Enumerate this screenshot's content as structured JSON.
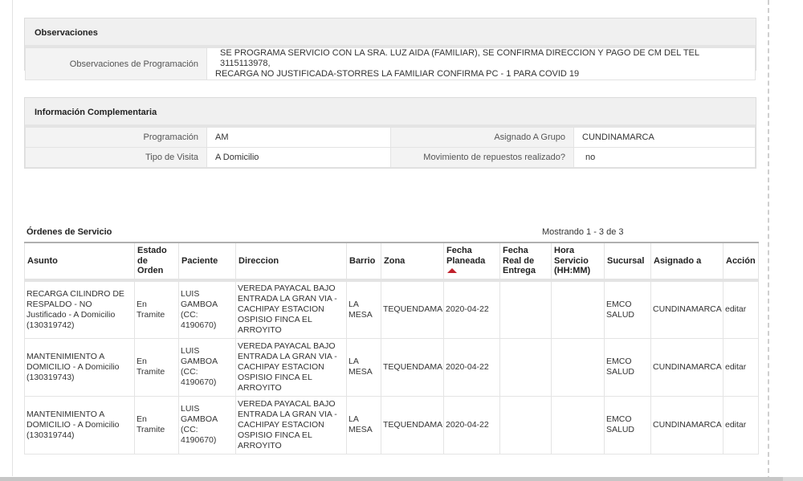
{
  "observaciones": {
    "title": "Observaciones",
    "label": "Observaciones de Programación",
    "value_line1": "SE PROGRAMA SERVICIO CON LA SRA. LUZ AIDA (FAMILIAR), SE CONFIRMA DIRECCION Y PAGO DE CM DEL TEL 3115113978,",
    "value_line2": "RECARGA NO JUSTIFICADA-STORRES LA FAMILIAR CONFIRMA PC - 1 PARA COVID 19"
  },
  "info": {
    "title": "Información Complementaria",
    "programacion_label": "Programación",
    "programacion_value": "AM",
    "grupo_label": "Asignado A Grupo",
    "grupo_value": "CUNDINAMARCA",
    "visita_label": "Tipo de Visita",
    "visita_value": "A Domicilio",
    "repuestos_label": "Movimiento de repuestos realizado?",
    "repuestos_value": "no"
  },
  "orders": {
    "title": "Órdenes de Servicio",
    "count_text": "Mostrando 1 - 3 de 3",
    "sort_color": "#c0202a",
    "headers": {
      "asunto": "Asunto",
      "estado": "Estado de Orden",
      "paciente": "Paciente",
      "direccion": "Direccion",
      "barrio": "Barrio",
      "zona": "Zona",
      "fecha_planeada": "Fecha Planeada",
      "fecha_real": "Fecha Real de Entrega",
      "hora": "Hora Servicio (HH:MM)",
      "sucursal": "Sucursal",
      "asignado": "Asignado a",
      "accion": "Acción"
    },
    "rows": [
      {
        "asunto": "RECARGA CILINDRO DE RESPALDO - NO Justificado - A Domicilio (130319742)",
        "estado": "En Tramite",
        "paciente": "LUIS GAMBOA (CC: 4190670)",
        "direccion": "VEREDA PAYACAL BAJO ENTRADA LA GRAN VIA - CACHIPAY ESTACION OSPISIO FINCA EL ARROYITO",
        "barrio": "LA MESA",
        "zona": "TEQUENDAMA",
        "fecha_planeada": "2020-04-22",
        "fecha_real": "",
        "hora": "",
        "sucursal": "EMCO SALUD",
        "asignado": "CUNDINAMARCA",
        "accion": "editar"
      },
      {
        "asunto": "MANTENIMIENTO A DOMICILIO - A Domicilio (130319743)",
        "estado": "En Tramite",
        "paciente": "LUIS GAMBOA (CC: 4190670)",
        "direccion": "VEREDA PAYACAL BAJO ENTRADA LA GRAN VIA - CACHIPAY ESTACION OSPISIO FINCA EL ARROYITO",
        "barrio": "LA MESA",
        "zona": "TEQUENDAMA",
        "fecha_planeada": "2020-04-22",
        "fecha_real": "",
        "hora": "",
        "sucursal": "EMCO SALUD",
        "asignado": "CUNDINAMARCA",
        "accion": "editar"
      },
      {
        "asunto": "MANTENIMIENTO A DOMICILIO - A Domicilio (130319744)",
        "estado": "En Tramite",
        "paciente": "LUIS GAMBOA (CC: 4190670)",
        "direccion": "VEREDA PAYACAL BAJO ENTRADA LA GRAN VIA - CACHIPAY ESTACION OSPISIO FINCA EL ARROYITO",
        "barrio": "LA MESA",
        "zona": "TEQUENDAMA",
        "fecha_planeada": "2020-04-22",
        "fecha_real": "",
        "hora": "",
        "sucursal": "EMCO SALUD",
        "asignado": "CUNDINAMARCA",
        "accion": "editar"
      }
    ]
  }
}
